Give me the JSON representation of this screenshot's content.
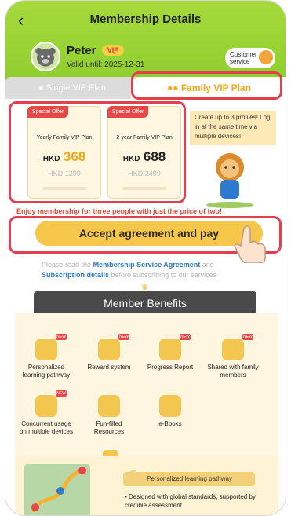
{
  "header": {
    "title": "Membership Details",
    "user_name": "Peter",
    "vip_badge": "VIP",
    "valid_until": "Valid until: 2025-12-31",
    "customer_service": "Customer service"
  },
  "tabs": {
    "single": "Single VIP Plan",
    "family": "Family VIP Plan"
  },
  "plans": [
    {
      "tag": "Special Offer",
      "name": "Yearly Family VIP Plan",
      "currency": "HKD",
      "price": "368",
      "old_price": "HKD 1299"
    },
    {
      "tag": "Special Offer",
      "name": "2-year Family VIP Plan",
      "currency": "HKD",
      "price": "688",
      "old_price": "HKD 2499"
    }
  ],
  "promo_text": "Create up to 3 profiles! Log in at the same time via multiple devices!",
  "enjoy_text": "Enjoy membership for three people with just the price of two!",
  "pay_button": "Accept agreement and pay",
  "agreement": {
    "line1_prefix": "Please read the",
    "line1_link": "Membership Service Agreement",
    "line1_suffix": "and",
    "line2_link": "Subscription details",
    "line2_suffix": "before subscribing to our services"
  },
  "benefits": {
    "title": "Member Benefits",
    "items": [
      {
        "label": "Personalized learning pathway",
        "icon": "pathway-icon",
        "new": "NEW"
      },
      {
        "label": "Reward system",
        "icon": "star-icon",
        "new": "NEW"
      },
      {
        "label": "Progress Report",
        "icon": "report-icon",
        "new": "NEW"
      },
      {
        "label": "Shared with family members",
        "icon": "family-icon",
        "new": "NEW"
      },
      {
        "label": "Concurrent usage on multiple devices",
        "icon": "devices-icon",
        "new": "NEW"
      },
      {
        "label": "Fun-filled Resources",
        "icon": "folder-icon",
        "new": ""
      },
      {
        "label": "e-Books",
        "icon": "ebook-icon",
        "new": ""
      }
    ]
  },
  "bottom_card": {
    "pill": "Personalized learning pathway",
    "bullet": "• Designed with global standards, supported by credible assessment"
  },
  "colors": {
    "header_green": "#8fce2e",
    "accent_yellow": "#f7c74b",
    "highlight_red": "#e04050",
    "link_blue": "#2f78c6"
  }
}
